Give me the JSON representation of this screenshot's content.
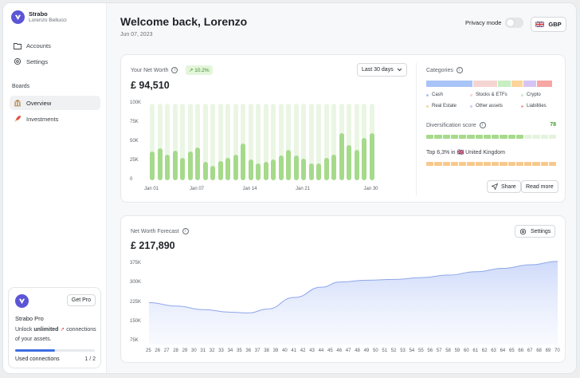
{
  "sidebar": {
    "brand": "Strabo",
    "user": "Lorenzo Bellucci",
    "accounts_label": "Accounts",
    "settings_label": "Settings",
    "boards_label": "Boards",
    "overview_label": "Overview",
    "investments_label": "Investments",
    "pro": {
      "button": "Get Pro",
      "title": "Strabo Pro",
      "desc_pre": "Unlock ",
      "desc_strong": "unlimited",
      "desc_post": " connections of your assets.",
      "used_label": "Used connections",
      "count": "1 / 2",
      "progress": 0.5
    }
  },
  "header": {
    "title": "Welcome back, Lorenzo",
    "date": "Jun 07, 2023",
    "privacy_label": "Privacy mode",
    "privacy_on": false,
    "currency": "GBP"
  },
  "net_worth": {
    "label": "Your Net Worth",
    "badge": "↗ 10.2%",
    "value": "£ 94,510",
    "range": "Last 30 days",
    "y_ticks": [
      "100K",
      "75K",
      "50K",
      "25K",
      "0"
    ],
    "x_ticks": [
      "Jan 01",
      "Jan 07",
      "Jan 14",
      "Jan 21",
      "Jan 30"
    ]
  },
  "categories": {
    "label": "Categories",
    "segments": [
      {
        "name": "Cash",
        "color": "#a9c4f7",
        "share": 0.37
      },
      {
        "name": "Stocks & ETFs",
        "color": "#f5d5d2",
        "share": 0.19
      },
      {
        "name": "Crypto",
        "color": "#c8eec1",
        "share": 0.1
      },
      {
        "name": "Real Estate",
        "color": "#fbd59a",
        "share": 0.09
      },
      {
        "name": "Other assets",
        "color": "#d6c4f4",
        "share": 0.1
      },
      {
        "name": "Liabilities",
        "color": "#f6a7a4",
        "share": 0.12
      }
    ],
    "diversification_label": "Diversification score",
    "diversification_score": "78",
    "top_label": "Top 6,3% in 🇬🇧 United Kingdom",
    "share_label": "Share",
    "readmore_label": "Read more"
  },
  "forecast": {
    "label": "Net Worth Forecast",
    "value": "£ 217,890",
    "settings_label": "Settings",
    "y_ticks": [
      "375K",
      "300K",
      "225K",
      "150K",
      "75K"
    ],
    "x_ticks": [
      "25",
      "26",
      "27",
      "28",
      "29",
      "30",
      "31",
      "32",
      "33",
      "34",
      "35",
      "36",
      "37",
      "38",
      "39",
      "40",
      "41",
      "42",
      "43",
      "44",
      "45",
      "46",
      "47",
      "48",
      "49",
      "50",
      "51",
      "52",
      "53",
      "54",
      "55",
      "56",
      "57",
      "58",
      "59",
      "60",
      "61",
      "62",
      "63",
      "64",
      "65",
      "66",
      "67",
      "68",
      "69",
      "70"
    ]
  },
  "chart_data": [
    {
      "type": "bar",
      "title": "Your Net Worth",
      "categories": [
        "Jan 01",
        "Jan 02",
        "Jan 03",
        "Jan 04",
        "Jan 05",
        "Jan 06",
        "Jan 07",
        "Jan 08",
        "Jan 09",
        "Jan 10",
        "Jan 11",
        "Jan 12",
        "Jan 13",
        "Jan 14",
        "Jan 15",
        "Jan 16",
        "Jan 17",
        "Jan 18",
        "Jan 19",
        "Jan 20",
        "Jan 21",
        "Jan 22",
        "Jan 23",
        "Jan 24",
        "Jan 25",
        "Jan 26",
        "Jan 27",
        "Jan 28",
        "Jan 29",
        "Jan 30"
      ],
      "values": [
        37,
        42,
        33,
        39,
        29,
        37,
        43,
        24,
        19,
        25,
        29,
        33,
        48,
        27,
        22,
        24,
        27,
        32,
        40,
        32,
        28,
        22,
        22,
        29,
        33,
        61,
        46,
        40,
        55,
        61
      ],
      "ylabel": "",
      "ylim": [
        0,
        100
      ],
      "grid": false
    },
    {
      "type": "area",
      "title": "Net Worth Forecast",
      "x": [
        25,
        28,
        31,
        34,
        36,
        38,
        41,
        44,
        46,
        49,
        52,
        55,
        58,
        61,
        64,
        67,
        70
      ],
      "values": [
        225,
        212,
        198,
        188,
        185,
        200,
        245,
        285,
        305,
        312,
        315,
        322,
        332,
        345,
        358,
        372,
        385
      ],
      "ylim": [
        75,
        375
      ],
      "grid": false
    }
  ]
}
